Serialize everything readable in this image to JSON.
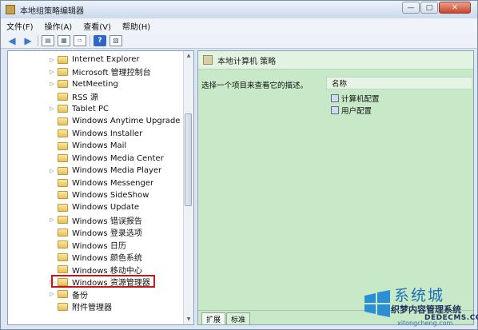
{
  "window": {
    "title": "本地组策略编辑器"
  },
  "menu": [
    "文件(F)",
    "操作(A)",
    "查看(V)",
    "帮助(H)"
  ],
  "tree": {
    "items": [
      "Internet Explorer",
      "Microsoft 管理控制台",
      "NetMeeting",
      "RSS 源",
      "Tablet PC",
      "Windows Anytime Upgrade",
      "Windows Installer",
      "Windows Mail",
      "Windows Media Center",
      "Windows Media Player",
      "Windows Messenger",
      "Windows SideShow",
      "Windows Update",
      "Windows 错误报告",
      "Windows 登录选项",
      "Windows 日历",
      "Windows 颜色系统",
      "Windows 移动中心",
      "Windows 资源管理器",
      "备份",
      "附件管理器"
    ],
    "expandable": [
      true,
      true,
      true,
      false,
      true,
      false,
      false,
      false,
      false,
      true,
      false,
      false,
      false,
      true,
      false,
      false,
      false,
      false,
      true,
      true,
      false
    ],
    "highlighted_index": 18
  },
  "right": {
    "header_title": "本地计算机 策略",
    "description": "选择一个项目来查看它的描述。",
    "column_name": "名称",
    "items": [
      "计算机配置",
      "用户配置"
    ],
    "tabs": [
      "扩展",
      "标准"
    ],
    "active_tab": 0
  },
  "watermark": {
    "site": "系统城",
    "cn": "织梦内容管理系统",
    "en": "DEDECMS.COM",
    "url": "xitongcheng.com"
  },
  "colors": {
    "highlight_border": "#c4161c",
    "right_pane_bg": "#c7e9c7"
  }
}
